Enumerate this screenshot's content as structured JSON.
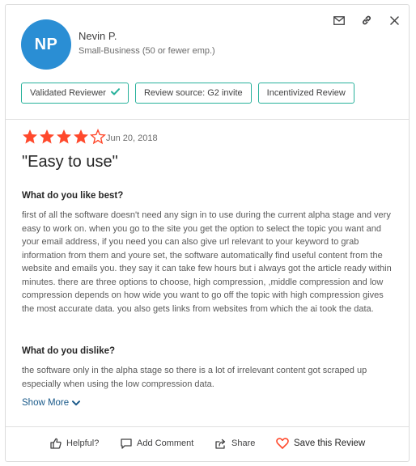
{
  "reviewer": {
    "initials": "NP",
    "name": "Nevin P.",
    "company_size": "Small-Business (50 or fewer emp.)",
    "avatar_color": "#2a8ed4"
  },
  "header_icons": [
    "envelope-icon",
    "link-icon",
    "close-icon"
  ],
  "badges": {
    "validated": "Validated Reviewer",
    "source": "Review source: G2 invite",
    "incentivized": "Incentivized Review"
  },
  "review": {
    "rating": 4,
    "max_rating": 5,
    "star_color": "#ff492c",
    "date": "Jun 20, 2018",
    "title": "\"Easy to use\"",
    "like_question": "What do you like best?",
    "like_answer": "first of all the software doesn't need any sign in to use during the current alpha stage and very easy to work on. when you go to the site you get the option to select the topic you want and your email address, if you need you can also give url relevant to your keyword to grab information from them and youre set, the software automatically find useful content from the website and emails you. they say it can take few hours but i always got the article ready within minutes. there are three options to choose, high compression, ,middle compression and low compression depends on how wide you want to go off the topic with high compression gives the most accurate data. you also gets links from websites from which the ai took the data.",
    "dislike_question": "What do you dislike?",
    "dislike_answer": "the software only in the alpha stage so there is a lot of irrelevant content got scraped up especially when using the low compression data.",
    "show_more": "Show More"
  },
  "actions": {
    "helpful": "Helpful?",
    "comment": "Add Comment",
    "share": "Share",
    "save": "Save this Review"
  },
  "colors": {
    "accent_green": "#27b19b",
    "link_blue": "#1a5a8a",
    "heart_red": "#ff492c"
  }
}
